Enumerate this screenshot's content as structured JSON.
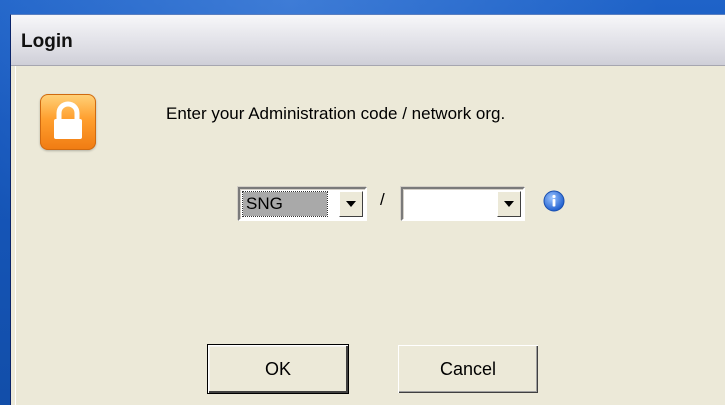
{
  "window": {
    "title": "Login"
  },
  "dialog": {
    "prompt": "Enter your Administration code / network org.",
    "icon": "lock-icon",
    "admin_code": {
      "selected_value": "SNG"
    },
    "separator": "/",
    "network_org": {
      "selected_value": ""
    },
    "info_icon": "info-icon"
  },
  "buttons": {
    "ok_label": "OK",
    "cancel_label": "Cancel"
  },
  "colors": {
    "desktop_blue": "#1758bd",
    "dialog_face": "#ece9d8",
    "lock_orange": "#f07b12",
    "info_blue": "#2f6fd6"
  }
}
